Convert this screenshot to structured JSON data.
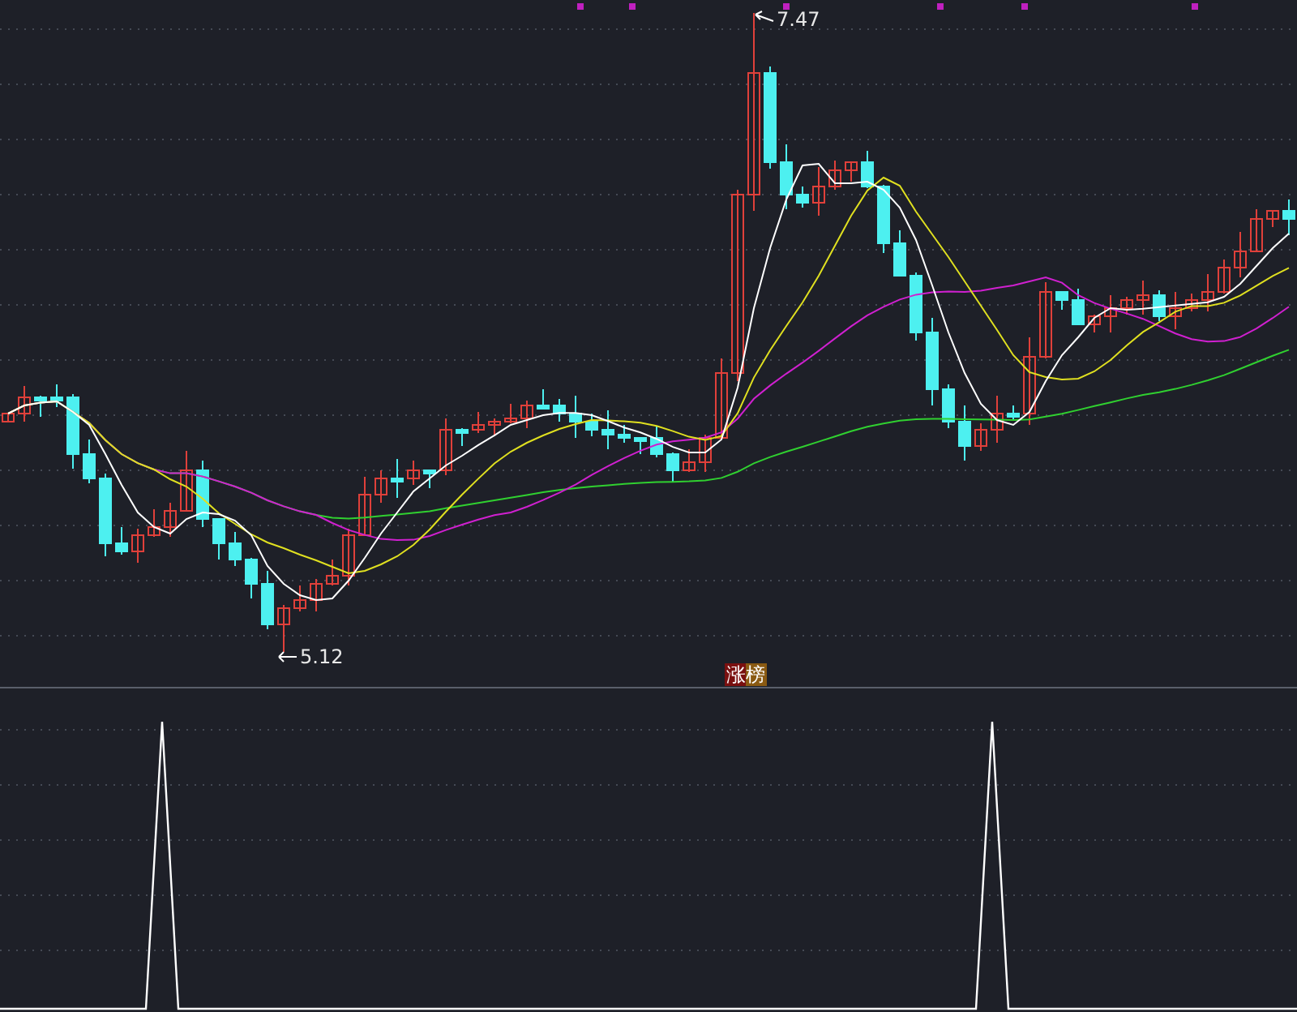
{
  "price_chart": {
    "high_label": "7.47",
    "low_label": "5.12",
    "signal_badge": "涨榜"
  }
}
